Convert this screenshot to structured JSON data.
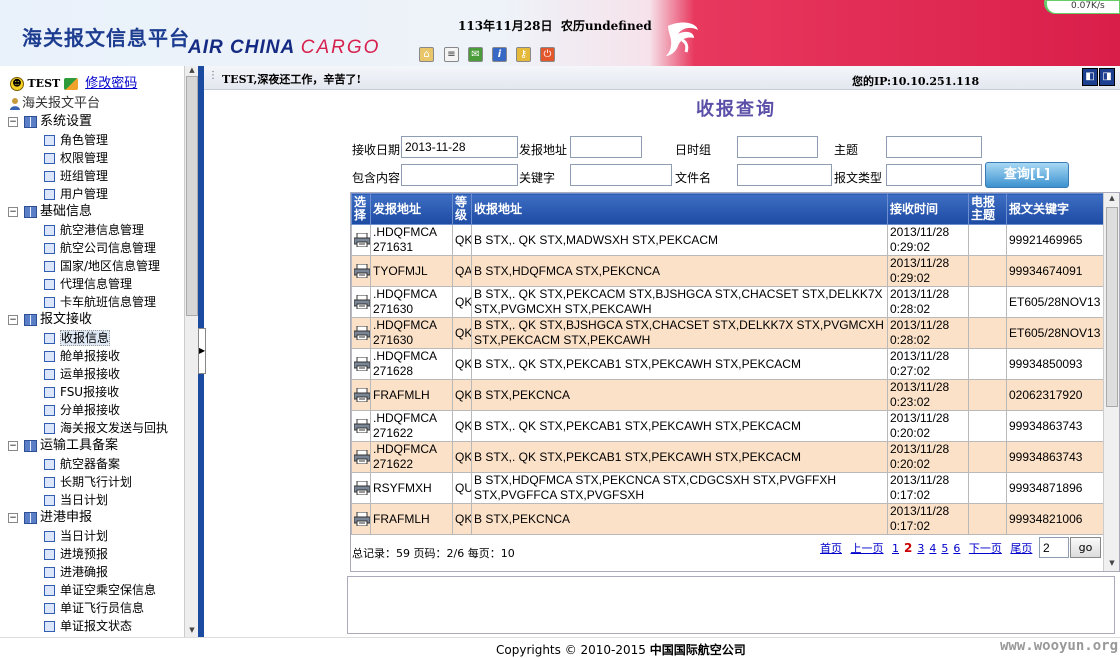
{
  "header": {
    "title": "海关报文信息平台",
    "airline_brand_main": "AIR CHINA ",
    "airline_brand_cargo": "CARGO",
    "date_text": "113年11月28日",
    "lunar_label": "农历undefined",
    "toolbar_icons": [
      "home-icon",
      "notepad-icon",
      "mail-icon",
      "info-icon",
      "key-icon",
      "exit-icon"
    ],
    "accent_color": "#d91e4a",
    "badge_text": "0.07K/s"
  },
  "sidebar": {
    "user": "TEST",
    "change_password": "修改密码",
    "root": "海关报文平台",
    "groups": [
      {
        "label": "系统设置",
        "items": [
          "角色管理",
          "权限管理",
          "班组管理",
          "用户管理"
        ]
      },
      {
        "label": "基础信息",
        "items": [
          "航空港信息管理",
          "航空公司信息管理",
          "国家/地区信息管理",
          "代理信息管理",
          "卡车航班信息管理"
        ]
      },
      {
        "label": "报文接收",
        "items": [
          "收报信息",
          "舱单报接收",
          "运单报接收",
          "FSU报接收",
          "分单报接收",
          "海关报文发送与回执"
        ]
      },
      {
        "label": "运输工具备案",
        "items": [
          "航空器备案",
          "长期飞行计划",
          "当日计划"
        ]
      },
      {
        "label": "进港申报",
        "items": [
          "当日计划",
          "进境预报",
          "进港确报",
          "单证空乘空保信息",
          "单证飞行员信息",
          "单证报文状态"
        ]
      }
    ]
  },
  "topbar": {
    "greeting": "TEST,深夜还工作，辛苦了!",
    "ip": "您的IP:10.10.251.118"
  },
  "form": {
    "title": "收报查询",
    "recv_date_label": "接收日期",
    "recv_date_value": "2013-11-28",
    "send_addr_label": "发报地址",
    "send_addr_value": "",
    "dtg_label": "日时组",
    "dtg_value": "",
    "subject_label": "主题",
    "subject_value": "",
    "content_label": "包含内容",
    "content_value": "",
    "keyword_label": "关键字",
    "keyword_value": "",
    "filename_label": "文件名",
    "filename_value": "",
    "msgtype_label": "报文类型",
    "msgtype_value": "",
    "query_button": "查询[L]"
  },
  "table": {
    "columns": [
      "选择",
      "发报地址",
      "等级",
      "收报地址",
      "接收时间",
      "电报主题",
      "报文关键字"
    ],
    "rows": [
      {
        "from": ".HDQFMCA",
        "from2": "271631",
        "level": "QK",
        "to": "B STX,. QK STX,MADWSXH STX,PEKCACM",
        "to2": "",
        "date": "2013/11/28",
        "time": "0:29:02",
        "subject": "",
        "key": "99921469965"
      },
      {
        "from": "TYOFMJL",
        "from2": "",
        "level": "QA",
        "to": "B STX,HDQFMCA STX,PEKCNCA",
        "to2": "",
        "date": "2013/11/28",
        "time": "0:29:02",
        "subject": "",
        "key": "99934674091"
      },
      {
        "from": ".HDQFMCA",
        "from2": "271630",
        "level": "QK",
        "to": "B STX,. QK STX,PEKCACM STX,BJSHGCA STX,CHACSET STX,DELKK7X",
        "to2": "STX,PVGMCXH STX,PEKCAWH",
        "date": "2013/11/28",
        "time": "0:28:02",
        "subject": "",
        "key": "ET605/28NOV13"
      },
      {
        "from": ".HDQFMCA",
        "from2": "271630",
        "level": "QK",
        "to": "B STX,. QK STX,BJSHGCA STX,CHACSET STX,DELKK7X STX,PVGMCXH",
        "to2": "STX,PEKCACM STX,PEKCAWH",
        "date": "2013/11/28",
        "time": "0:28:02",
        "subject": "",
        "key": "ET605/28NOV13"
      },
      {
        "from": ".HDQFMCA",
        "from2": "271628",
        "level": "QK",
        "to": "B STX,. QK STX,PEKCAB1 STX,PEKCAWH STX,PEKCACM",
        "to2": "",
        "date": "2013/11/28",
        "time": "0:27:02",
        "subject": "",
        "key": "99934850093"
      },
      {
        "from": "FRAFMLH",
        "from2": "",
        "level": "QK",
        "to": "B STX,PEKCNCA",
        "to2": "",
        "date": "2013/11/28",
        "time": "0:23:02",
        "subject": "",
        "key": "02062317920"
      },
      {
        "from": ".HDQFMCA",
        "from2": "271622",
        "level": "QK",
        "to": "B STX,. QK STX,PEKCAB1 STX,PEKCAWH STX,PEKCACM",
        "to2": "",
        "date": "2013/11/28",
        "time": "0:20:02",
        "subject": "",
        "key": "99934863743"
      },
      {
        "from": ".HDQFMCA",
        "from2": "271622",
        "level": "QK",
        "to": "B STX,. QK STX,PEKCAB1 STX,PEKCAWH STX,PEKCACM",
        "to2": "",
        "date": "2013/11/28",
        "time": "0:20:02",
        "subject": "",
        "key": "99934863743"
      },
      {
        "from": "RSYFMXH",
        "from2": "",
        "level": "QU",
        "to": "B STX,HDQFMCA STX,PEKCNCA STX,CDGCSXH STX,PVGFFXH",
        "to2": "STX,PVGFFCA STX,PVGFSXH",
        "date": "2013/11/28",
        "time": "0:17:02",
        "subject": "",
        "key": "99934871896"
      },
      {
        "from": "FRAFMLH",
        "from2": "",
        "level": "QK",
        "to": "B STX,PEKCNCA",
        "to2": "",
        "date": "2013/11/28",
        "time": "0:17:02",
        "subject": "",
        "key": "99934821006"
      }
    ]
  },
  "pager": {
    "summary": "总记录：59 页码：2/6 每页：10",
    "first": "首页",
    "prev": "上一页",
    "pages": [
      "1",
      "2",
      "3",
      "4",
      "5",
      "6"
    ],
    "current": "2",
    "next": "下一页",
    "last": "尾页",
    "input_value": "2",
    "go": "go"
  },
  "footer": {
    "copyright_prefix": "Copyrights © 2010-2015 ",
    "company": "中国国际航空公司",
    "watermark": "www.wooyun.org"
  }
}
